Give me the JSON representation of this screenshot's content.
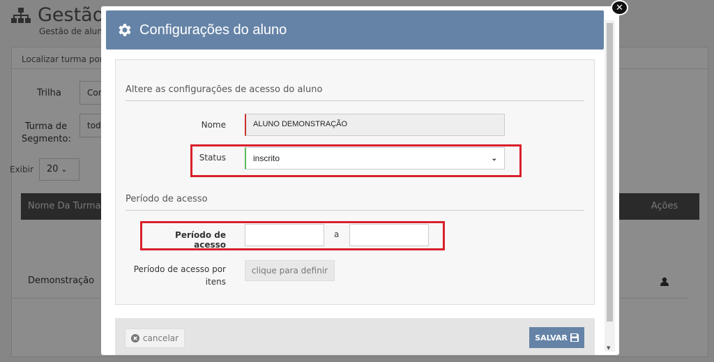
{
  "background": {
    "title": "Gestão",
    "subtitle": "Gestão de alun",
    "locate_label": "Localizar turma por",
    "trilha_label": "Trilha",
    "trilha_value": "Con",
    "turma_label": "Turma de Segmento:",
    "turma_value": "tod",
    "exibir_label": "Exibir",
    "exibir_value": "20",
    "col_nome": "Nome Da Turma",
    "col_acoes": "Ações",
    "row_nome": "Demonstração"
  },
  "modal": {
    "title": "Configurações do aluno",
    "section1_title": "Altere as configurações de acesso do aluno",
    "nome_label": "Nome",
    "nome_value": "ALUNO DEMONSTRAÇÃO",
    "status_label": "Status",
    "status_value": "inscrito",
    "section2_title": "Período de acesso",
    "periodo_label": "Período de acesso",
    "periodo_start": "",
    "periodo_sep": "a",
    "periodo_end": "",
    "periodo_itens_label": "Período de acesso por itens",
    "define_button": "clique para definir",
    "cancel_button": "cancelar",
    "save_button": "SALVAR"
  },
  "colors": {
    "header": "#6583a6",
    "highlight": "#d9202a",
    "required": "#c9302c",
    "valid": "#5cb85c"
  }
}
